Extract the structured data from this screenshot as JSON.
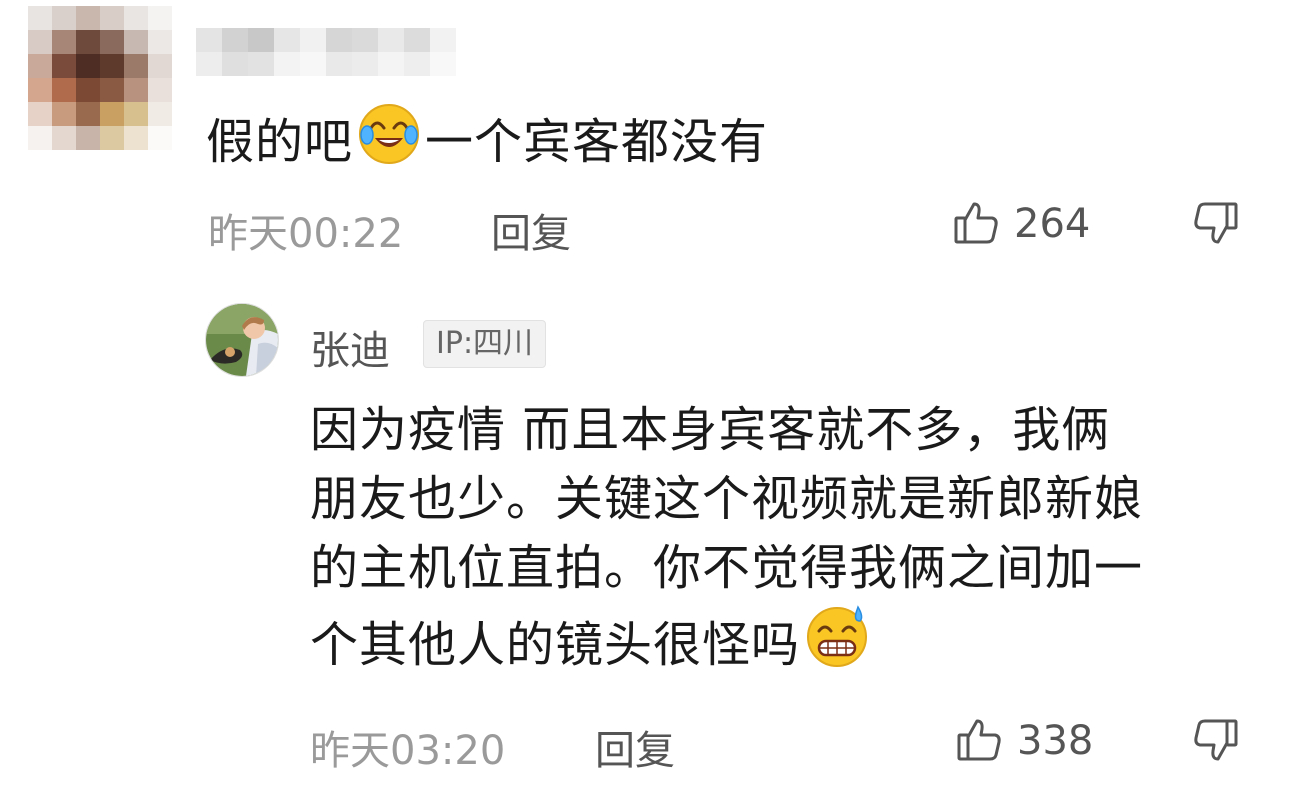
{
  "comment": {
    "text_before_emoji": "假的吧",
    "emoji": "crying-laughing-emoji",
    "text_after_emoji": "一个宾客都没有",
    "time": "昨天00:22",
    "reply_label": "回复",
    "like_count": "264"
  },
  "reply": {
    "username": "张迪",
    "ip_location": "IP:四川",
    "lines": [
      "因为疫情 而且本身宾客就不多，我俩",
      "朋友也少。关键这个视频就是新郎新娘",
      "的主机位直拍。你不觉得我俩之间加一",
      "个其他人的镜头很怪吗"
    ],
    "trailing_emoji": "grinning-sweat-emoji",
    "time": "昨天03:20",
    "reply_label": "回复",
    "like_count": "338"
  },
  "colors": {
    "text": "#1a1a1a",
    "meta": "#9a9a9a",
    "secondary": "#555555",
    "emoji_yellow": "#f9c623"
  }
}
